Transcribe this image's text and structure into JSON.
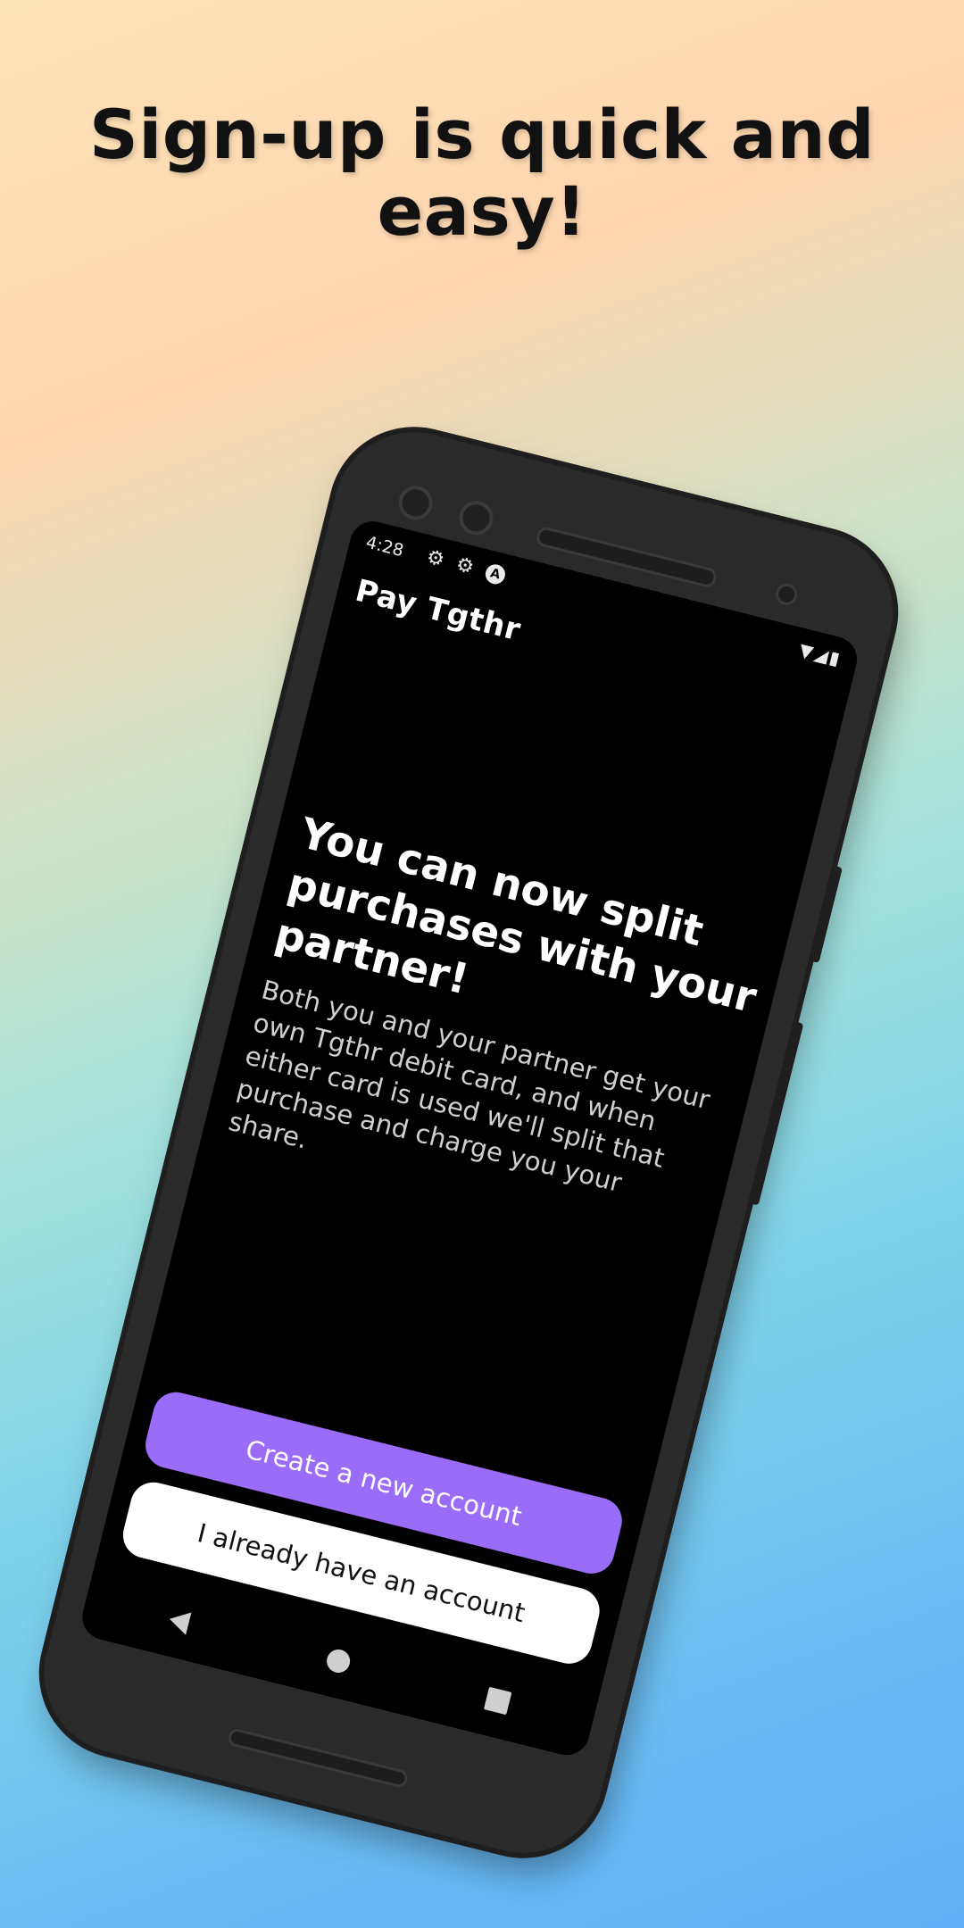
{
  "headline": "Sign-up is quick and easy!",
  "status_bar": {
    "time": "4:28",
    "icons": [
      "gear-icon",
      "gear-icon",
      "a-badge-icon"
    ],
    "right_icons": [
      "wifi-icon",
      "signal-icon",
      "battery-icon"
    ]
  },
  "app": {
    "name": "Pay Tgthr"
  },
  "onboarding": {
    "title": "You can now split purchases with your partner!",
    "description": "Both you and your partner get your own Tgthr debit card, and when either card is used we'll split that purchase and charge you your share."
  },
  "buttons": {
    "create_account": "Create a new account",
    "existing_account": "I already have an account"
  },
  "nav": {
    "items": [
      "back-icon",
      "home-icon",
      "recent-apps-icon"
    ]
  },
  "colors": {
    "primary_button": "#9b6cf7",
    "secondary_button": "#ffffff",
    "screen_background": "#000000"
  }
}
